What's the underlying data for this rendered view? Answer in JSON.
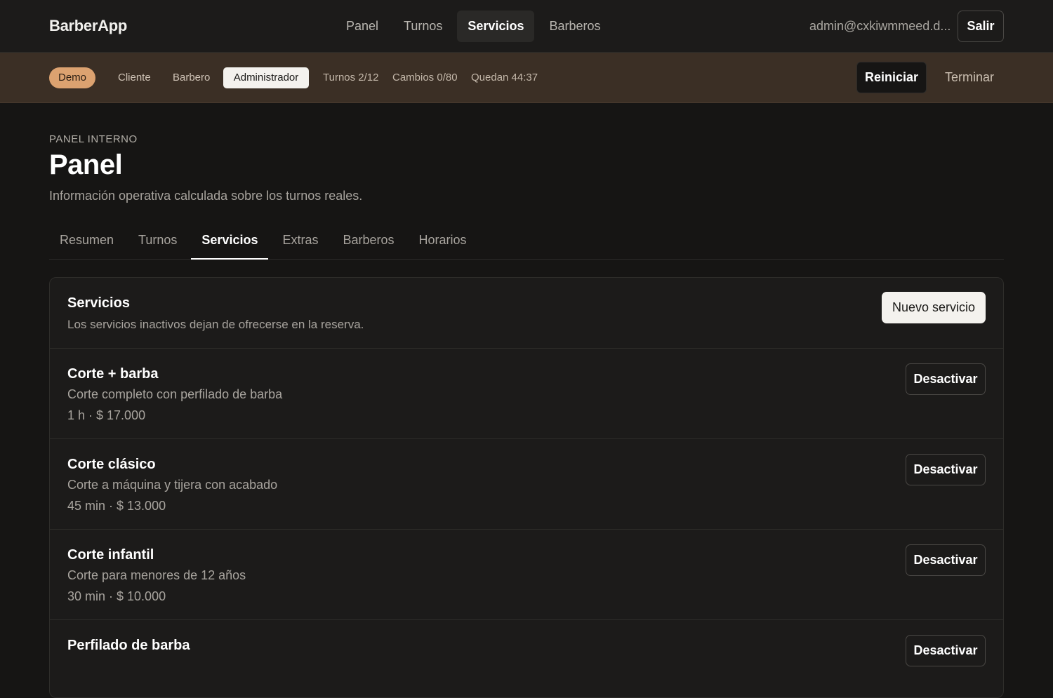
{
  "topbar": {
    "brand": "BarberApp",
    "nav": [
      "Panel",
      "Turnos",
      "Servicios",
      "Barberos"
    ],
    "active_nav": "Servicios",
    "user_email": "admin@cxkiwmmeed.d...",
    "logout_label": "Salir"
  },
  "demo_bar": {
    "badge": "Demo",
    "roles": {
      "cliente": "Cliente",
      "barbero": "Barbero",
      "admin": "Administrador"
    },
    "active_role": "Administrador",
    "stats": {
      "turnos": "Turnos 2/12",
      "cambios": "Cambios 0/80",
      "quedan": "Quedan 44:37"
    },
    "reset_label": "Reiniciar",
    "end_label": "Terminar"
  },
  "header": {
    "eyebrow": "PANEL INTERNO",
    "title": "Panel",
    "subtitle": "Información operativa calculada sobre los turnos reales."
  },
  "tabs": {
    "items": [
      "Resumen",
      "Turnos",
      "Servicios",
      "Extras",
      "Barberos",
      "Horarios"
    ],
    "active": "Servicios"
  },
  "services_card": {
    "title": "Servicios",
    "description": "Los servicios inactivos dejan de ofrecerse en la reserva.",
    "new_button": "Nuevo servicio",
    "items": [
      {
        "name": "Corte + barba",
        "description": "Corte completo con perfilado de barba",
        "meta": "1 h · $ 17.000",
        "action": "Desactivar"
      },
      {
        "name": "Corte clásico",
        "description": "Corte a máquina y tijera con acabado",
        "meta": "45 min · $ 13.000",
        "action": "Desactivar"
      },
      {
        "name": "Corte infantil",
        "description": "Corte para menores de 12 años",
        "meta": "30 min · $ 10.000",
        "action": "Desactivar"
      },
      {
        "name": "Perfilado de barba",
        "description": "",
        "meta": "",
        "action": "Desactivar"
      }
    ]
  },
  "colors": {
    "background": "#161514",
    "demo_bar": "#3b2f25",
    "demo_badge": "#dca270"
  }
}
